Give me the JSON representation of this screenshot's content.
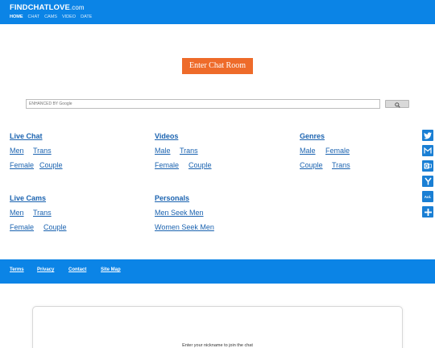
{
  "header": {
    "logo_main": "FINDCHATLOVE",
    "logo_domain": ".com",
    "nav": [
      "HOME",
      "CHAT",
      "CAMS",
      "VIDEO",
      "DATE"
    ],
    "accent": "#0b84e6"
  },
  "chat": {
    "enter_label": "Enter Chat Room",
    "button_color": "#ee6b2a"
  },
  "search": {
    "placeholder": "ENHANCED BY Google"
  },
  "sections": {
    "live_chat": {
      "title": "Live Chat",
      "links": [
        "Men",
        "Trans",
        "Female",
        "Couple"
      ]
    },
    "videos": {
      "title": "Videos",
      "links": [
        "Male",
        "Trans",
        "Female",
        "Couple"
      ]
    },
    "genres": {
      "title": "Genres",
      "links": [
        "Male",
        "Female",
        "Couple",
        "Trans"
      ]
    },
    "live_cams": {
      "title": "Live Cams",
      "links": [
        "Men",
        "Trans",
        "Female",
        "Couple"
      ]
    },
    "personals": {
      "title": "Personals",
      "links": [
        "Men Seek Men",
        "Women Seek Men"
      ]
    }
  },
  "share_icons": [
    "twitter-icon",
    "gmail-icon",
    "outlook-icon",
    "yahoo-icon",
    "aol-icon",
    "plus-icon"
  ],
  "share": {
    "aol_label": "Aol."
  },
  "footer": {
    "links": [
      "Terms",
      "Privacy",
      "Contact",
      "Site Map"
    ]
  },
  "panel": {
    "hint": "Enter your nickname to join the chat"
  }
}
